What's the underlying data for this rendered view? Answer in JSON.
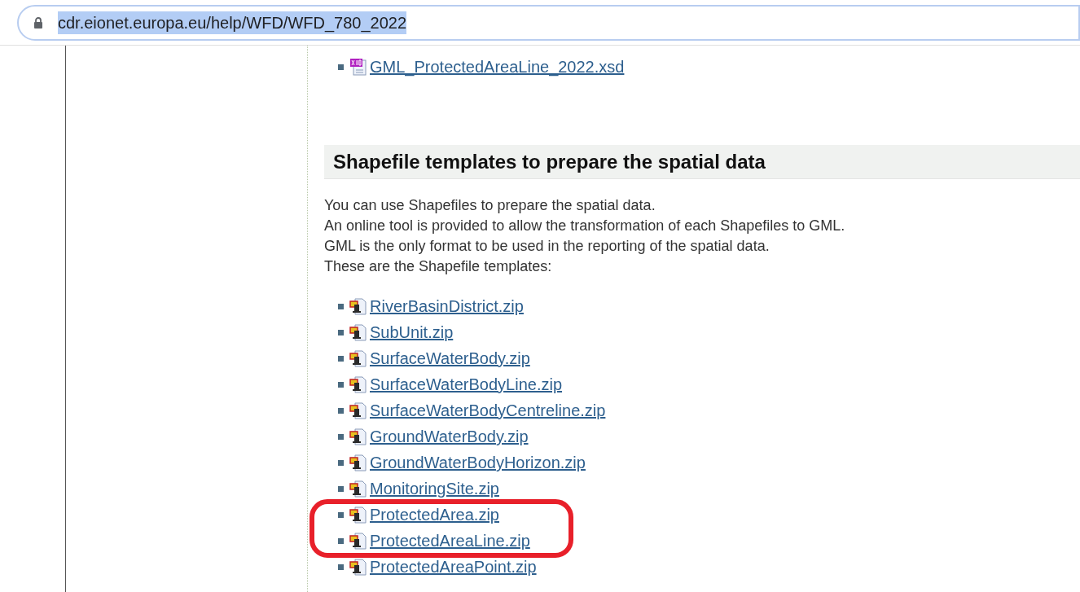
{
  "address_bar": {
    "url": "cdr.eionet.europa.eu/help/WFD/WFD_780_2022",
    "selected": true
  },
  "schema_files": [
    {
      "kind": "xsd",
      "label": "GML_ProtectedAreaLine_2022.xsd",
      "highlighted": false
    }
  ],
  "section": {
    "title": "Shapefile templates to prepare the spatial data",
    "paragraph": [
      "You can use Shapefiles to prepare the spatial data.",
      "An online tool is provided to allow the transformation of each Shapefiles to GML.",
      "GML is the only format to be used in the reporting of the spatial data.",
      "These are the Shapefile templates:"
    ],
    "files": [
      {
        "kind": "zip",
        "label": "RiverBasinDistrict.zip",
        "highlighted": false
      },
      {
        "kind": "zip",
        "label": "SubUnit.zip",
        "highlighted": false
      },
      {
        "kind": "zip",
        "label": "SurfaceWaterBody.zip",
        "highlighted": false
      },
      {
        "kind": "zip",
        "label": "SurfaceWaterBodyLine.zip",
        "highlighted": false
      },
      {
        "kind": "zip",
        "label": "SurfaceWaterBodyCentreline.zip",
        "highlighted": false
      },
      {
        "kind": "zip",
        "label": "GroundWaterBody.zip",
        "highlighted": false
      },
      {
        "kind": "zip",
        "label": "GroundWaterBodyHorizon.zip",
        "highlighted": false
      },
      {
        "kind": "zip",
        "label": "MonitoringSite.zip",
        "highlighted": false
      },
      {
        "kind": "zip",
        "label": "ProtectedArea.zip",
        "highlighted": true
      },
      {
        "kind": "zip",
        "label": "ProtectedAreaLine.zip",
        "highlighted": true
      },
      {
        "kind": "zip",
        "label": "ProtectedAreaPoint.zip",
        "highlighted": false
      }
    ]
  }
}
